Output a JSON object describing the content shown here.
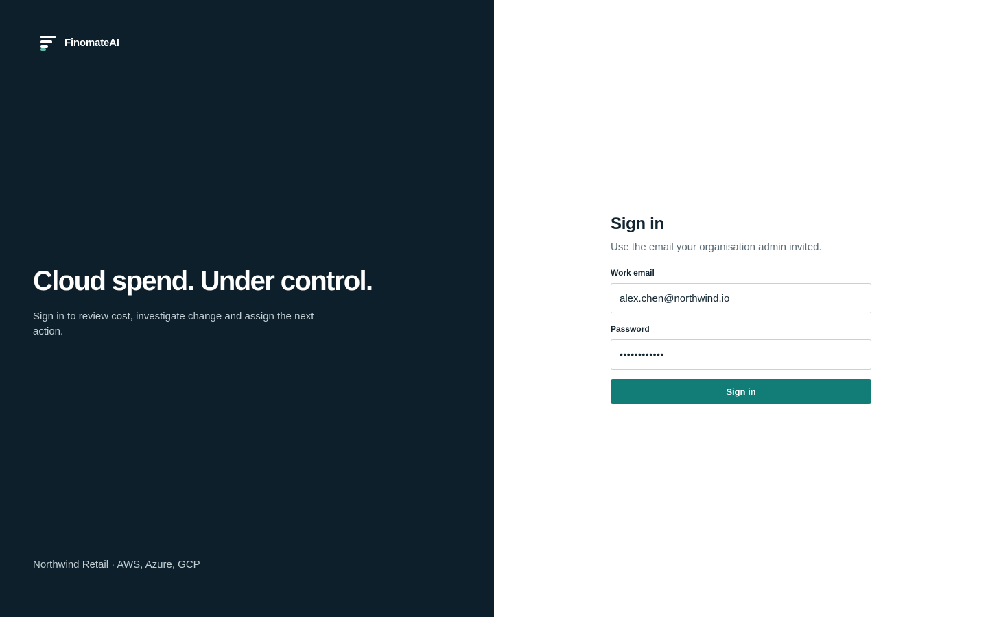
{
  "brand": {
    "name": "FinomateAI",
    "icon": "logo-bars-icon",
    "accent_color": "#5fb8a8"
  },
  "hero": {
    "title": "Cloud spend. Under control.",
    "subtitle": "Sign in to review cost, investigate change and assign the next action."
  },
  "footer": {
    "note": "Northwind Retail · AWS, Azure, GCP"
  },
  "signin": {
    "title": "Sign in",
    "subtitle": "Use the email your organisation admin invited.",
    "email_label": "Work email",
    "email_value": "alex.chen@northwind.io",
    "password_label": "Password",
    "password_value": "••••••••••••",
    "submit_label": "Sign in",
    "button_color": "#127c76"
  },
  "colors": {
    "left_panel_bg": "#0c1f2a",
    "right_panel_bg": "#ffffff"
  }
}
